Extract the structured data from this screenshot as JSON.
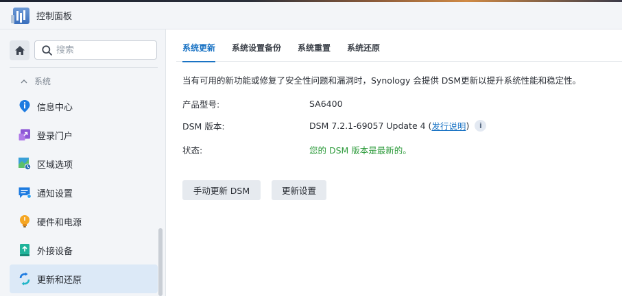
{
  "window": {
    "title": "控制面板"
  },
  "sidebar": {
    "search_placeholder": "搜索",
    "group_label": "系统",
    "items": [
      {
        "label": "信息中心",
        "icon": "info-icon"
      },
      {
        "label": "登录门户",
        "icon": "login-portal-icon"
      },
      {
        "label": "区域选项",
        "icon": "regional-options-icon"
      },
      {
        "label": "通知设置",
        "icon": "notification-icon"
      },
      {
        "label": "硬件和电源",
        "icon": "hardware-power-icon"
      },
      {
        "label": "外接设备",
        "icon": "external-devices-icon"
      },
      {
        "label": "更新和还原",
        "icon": "update-restore-icon",
        "active": true
      }
    ]
  },
  "main": {
    "tabs": [
      {
        "label": "系统更新",
        "active": true
      },
      {
        "label": "系统设置备份"
      },
      {
        "label": "系统重置"
      },
      {
        "label": "系统还原"
      }
    ],
    "description": "当有可用的新功能或修复了安全性问题和漏洞时，Synology 会提供 DSM更新以提升系统性能和稳定性。",
    "model": {
      "label": "产品型号:",
      "value": "SA6400"
    },
    "version": {
      "label": "DSM 版本:",
      "value": "DSM 7.2.1-69057 Update 4 (",
      "link": "发行说明",
      "suffix": ")"
    },
    "status": {
      "label": "状态:",
      "value": "您的 DSM 版本是最新的。"
    },
    "buttons": {
      "manual_update": "手动更新 DSM",
      "update_settings": "更新设置"
    }
  },
  "colors": {
    "accent": "#1a73c4",
    "success": "#2e9b3c",
    "active_bg": "#dce9f7"
  }
}
